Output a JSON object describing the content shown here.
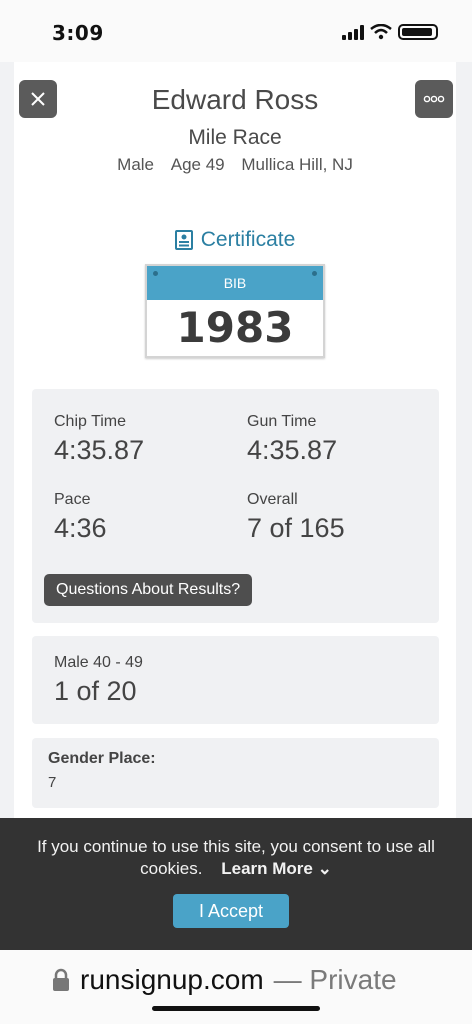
{
  "status_bar": {
    "time": "3:09"
  },
  "header": {
    "name": "Edward Ross",
    "race": "Mile Race",
    "gender": "Male",
    "age": "Age 49",
    "location": "Mullica Hill, NJ"
  },
  "certificate_label": "Certificate",
  "bib": {
    "label": "BIB",
    "number": "1983"
  },
  "results": {
    "chip_time_label": "Chip Time",
    "chip_time": "4:35.87",
    "gun_time_label": "Gun Time",
    "gun_time": "4:35.87",
    "pace_label": "Pace",
    "pace": "4:36",
    "overall_label": "Overall",
    "overall": "7 of 165",
    "questions_button": "Questions About Results?"
  },
  "division": {
    "label": "Male 40 - 49",
    "place": "1 of 20"
  },
  "gender_place": {
    "label": "Gender Place:",
    "value": "7"
  },
  "cookie_banner": {
    "text": "If you continue to use this site, you consent to use all cookies.",
    "learn_more": "Learn More",
    "accept": "I Accept"
  },
  "url_bar": {
    "domain": "runsignup.com",
    "suffix": "— Private"
  },
  "colors": {
    "accent": "#4aa3c8",
    "link": "#2b7fa2",
    "banner": "#333333"
  }
}
